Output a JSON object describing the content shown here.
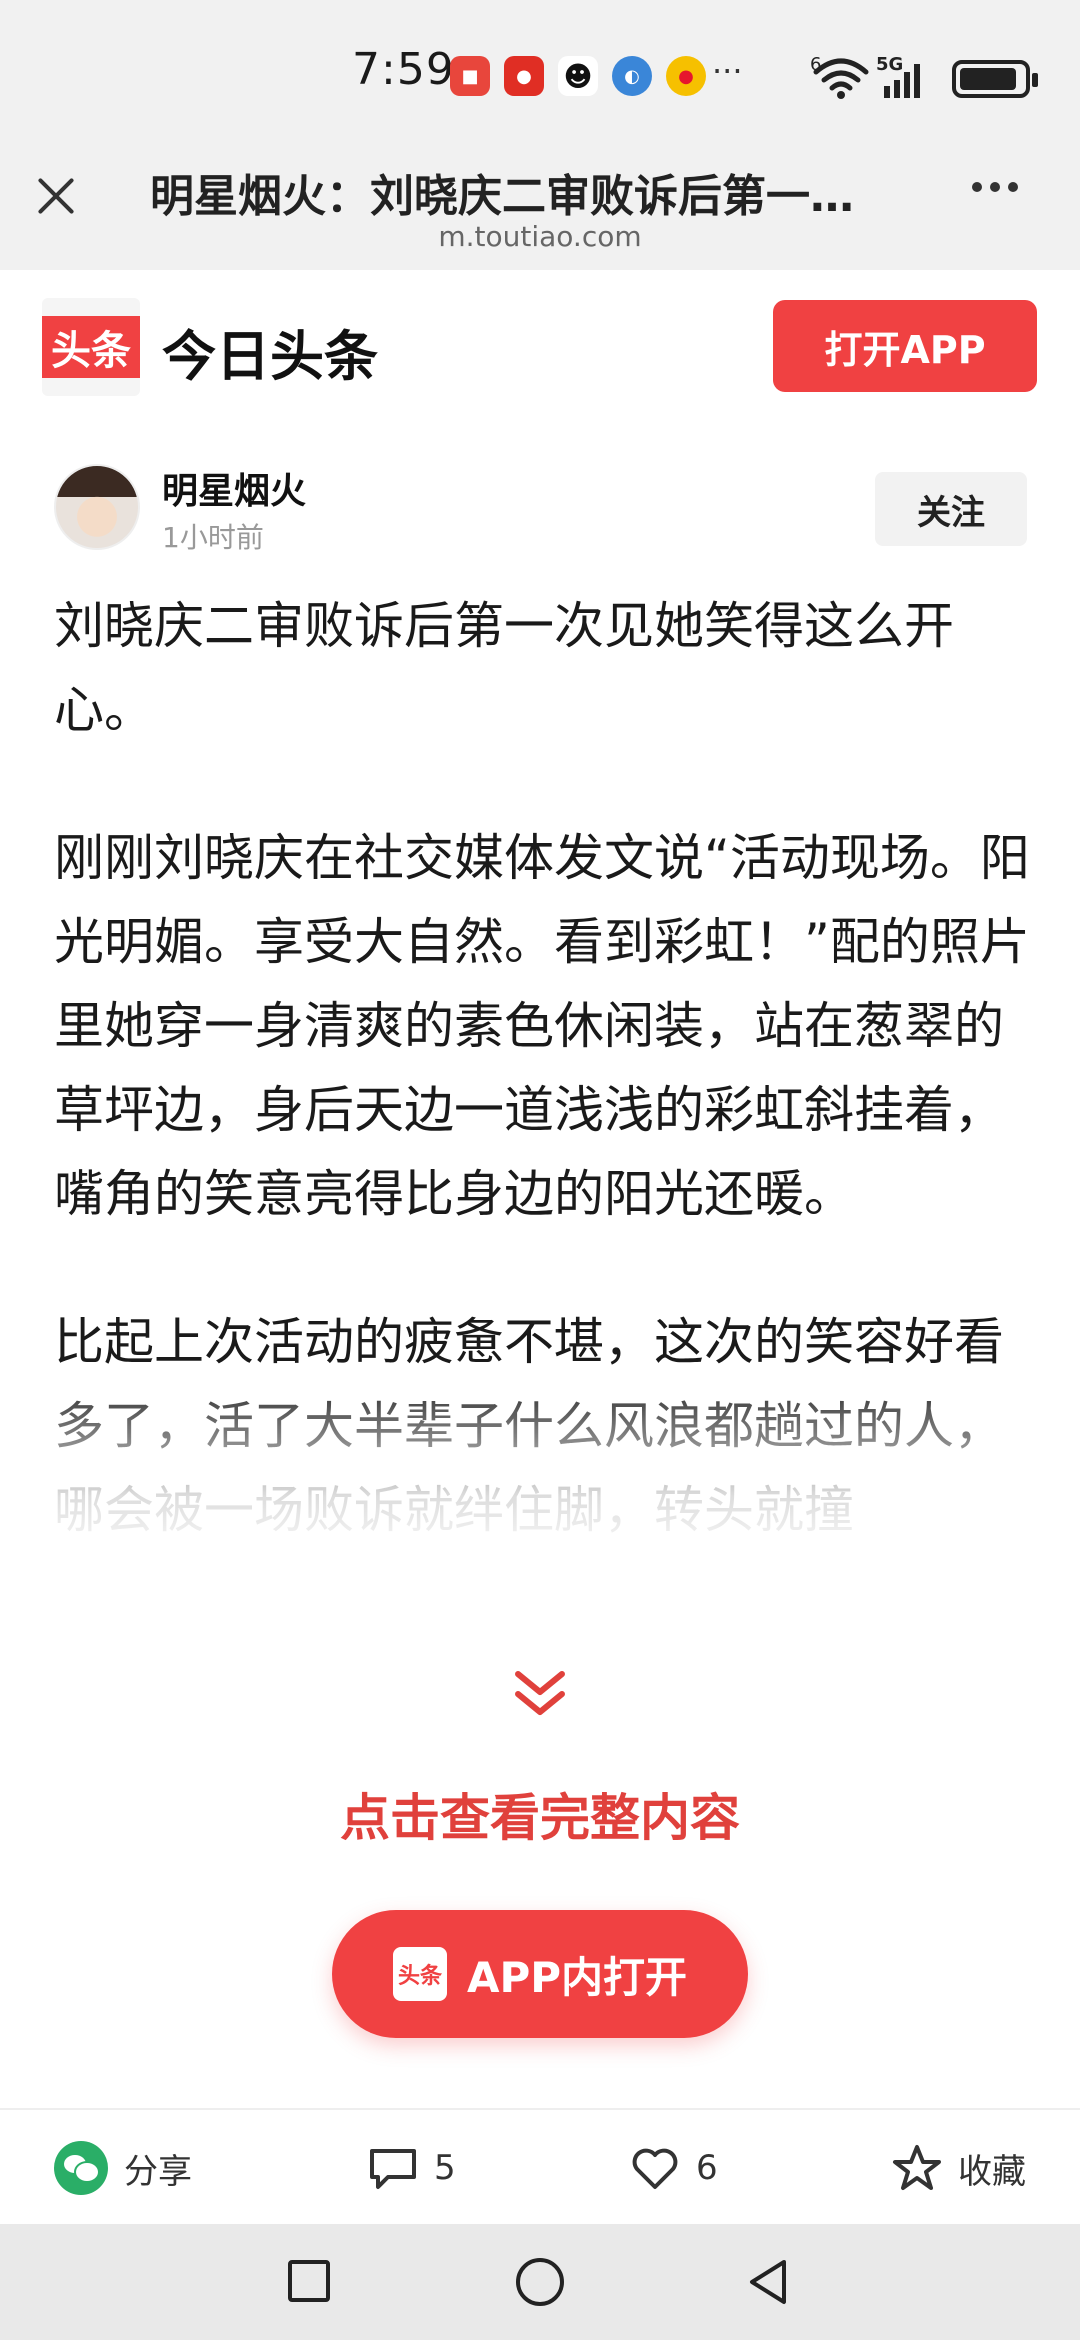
{
  "status_bar": {
    "time": "7:59",
    "network_label": "5G",
    "wifi_label": "6",
    "more": "···",
    "apps": [
      {
        "icon": "huawei-appgallery-icon",
        "color": "#e8463c"
      },
      {
        "icon": "pinduoduo-icon",
        "color": "#e02e24"
      },
      {
        "icon": "qq-icon",
        "color": "#1a1a1a"
      },
      {
        "icon": "browser-icon",
        "color": "#3a86d8"
      },
      {
        "icon": "weibo-icon",
        "color": "#e6162d"
      }
    ]
  },
  "browser": {
    "title": "明星烟火：刘晓庆二审败诉后第一…",
    "url": "m.toutiao.com"
  },
  "app_header": {
    "logo_text": "头条",
    "app_name": "今日头条",
    "open_app_label": "打开APP",
    "brand_color": "#f04142"
  },
  "author": {
    "name": "明星烟火",
    "time": "1小时前",
    "follow_label": "关注"
  },
  "article": {
    "paragraphs": [
      "刘晓庆二审败诉后第一次见她笑得这么开心。",
      "刚刚刘晓庆在社交媒体发文说“活动现场。阳光明媚。享受大自然。看到彩虹！”配的照片里她穿一身清爽的素色休闲装，站在葱翠的草坪边，身后天边一道浅浅的彩虹斜挂着，嘴角的笑意亮得比身边的阳光还暖。",
      "比起上次活动的疲惫不堪，这次的笑容好看多了，活了大半辈子什么风浪都趟过的人，哪会被一场败诉就绊住脚，转头就撞"
    ]
  },
  "expand": {
    "label": "点击查看完整内容",
    "app_open_icon_text": "头条",
    "app_open_label": "APP内打开",
    "accent_color": "#e0413c"
  },
  "actions": {
    "share_label": "分享",
    "comment_count": "5",
    "like_count": "6",
    "favorite_label": "收藏"
  }
}
